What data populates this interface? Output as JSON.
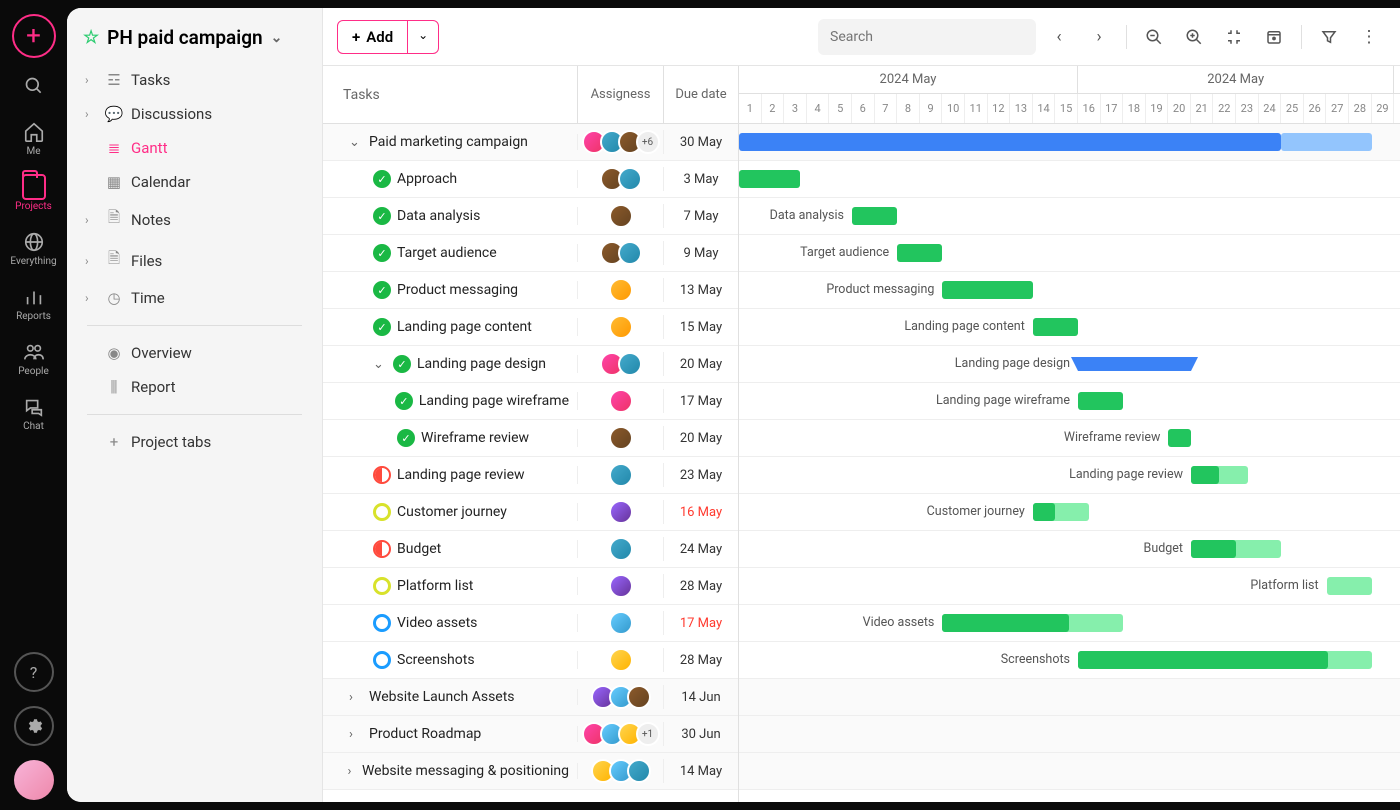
{
  "rail": {
    "items": [
      {
        "label": "Me"
      },
      {
        "label": "Projects"
      },
      {
        "label": "Everything"
      },
      {
        "label": "Reports"
      },
      {
        "label": "People"
      },
      {
        "label": "Chat"
      }
    ]
  },
  "project": {
    "title": "PH paid campaign"
  },
  "sidebar": {
    "items": [
      {
        "label": "Tasks"
      },
      {
        "label": "Discussions"
      },
      {
        "label": "Gantt"
      },
      {
        "label": "Calendar"
      },
      {
        "label": "Notes"
      },
      {
        "label": "Files"
      },
      {
        "label": "Time"
      }
    ],
    "secondary": [
      {
        "label": "Overview"
      },
      {
        "label": "Report"
      }
    ],
    "project_tabs": "Project tabs"
  },
  "toolbar": {
    "add_label": "Add",
    "search_placeholder": "Search"
  },
  "columns": {
    "tasks": "Tasks",
    "assignees": "Assigness",
    "due": "Due date"
  },
  "timeline": {
    "month_label": "2024 May",
    "days_start": 1,
    "days_end": 29,
    "split_day": 15,
    "day_width": 22.6
  },
  "tasks": [
    {
      "name": "Paid marketing campaign",
      "indent": 0,
      "chevron": "down",
      "status": null,
      "avatars": [
        "c1",
        "c2",
        "c3"
      ],
      "extra": "+6",
      "due": "30 May",
      "bar_type": "blue",
      "bar_start": 1,
      "bar_end": 25,
      "bar_ext_end": 29,
      "group": true
    },
    {
      "name": "Approach",
      "indent": 1,
      "status": "done",
      "avatars": [
        "c3",
        "c2"
      ],
      "due": "3 May",
      "bar_type": "green",
      "bar_start": 1,
      "bar_end": 3.7
    },
    {
      "name": "Data analysis",
      "indent": 1,
      "status": "done",
      "avatars": [
        "c3"
      ],
      "due": "7 May",
      "bar_type": "green",
      "bar_start": 6,
      "bar_end": 8,
      "label": "Data analysis"
    },
    {
      "name": "Target audience",
      "indent": 1,
      "status": "done",
      "avatars": [
        "c3",
        "c2"
      ],
      "due": "9 May",
      "bar_type": "green",
      "bar_start": 8,
      "bar_end": 10,
      "label": "Target audience"
    },
    {
      "name": "Product messaging",
      "indent": 1,
      "status": "done",
      "avatars": [
        "c4"
      ],
      "due": "13 May",
      "bar_type": "green",
      "bar_start": 10,
      "bar_end": 14,
      "label": "Product messaging"
    },
    {
      "name": "Landing page content",
      "indent": 1,
      "status": "done",
      "avatars": [
        "c4"
      ],
      "due": "15 May",
      "bar_type": "green",
      "bar_start": 14,
      "bar_end": 16,
      "label": "Landing page content"
    },
    {
      "name": "Landing page design",
      "indent": 1,
      "chevron": "down",
      "status": "done",
      "avatars": [
        "c1",
        "c2"
      ],
      "due": "20 May",
      "bar_type": "bracket",
      "bar_start": 16,
      "bar_end": 21,
      "label": "Landing page design"
    },
    {
      "name": "Landing page wireframe",
      "indent": 2,
      "status": "done",
      "avatars": [
        "c1"
      ],
      "due": "17 May",
      "bar_type": "green",
      "bar_start": 16,
      "bar_end": 18,
      "label": "Landing page wireframe"
    },
    {
      "name": "Wireframe review",
      "indent": 2,
      "status": "done",
      "avatars": [
        "c3"
      ],
      "due": "20 May",
      "bar_type": "green",
      "bar_start": 20,
      "bar_end": 21,
      "label": "Wireframe review"
    },
    {
      "name": "Landing page review",
      "indent": 1,
      "status": "half-red",
      "avatars": [
        "c2"
      ],
      "due": "23 May",
      "bar_type": "green-prog",
      "bar_start": 21,
      "bar_end": 23.5,
      "prog": 0.5,
      "label": "Landing page review"
    },
    {
      "name": "Customer journey",
      "indent": 1,
      "status": "ring-yellow",
      "avatars": [
        "c5"
      ],
      "due": "16 May",
      "overdue": true,
      "bar_type": "green-prog",
      "bar_start": 14,
      "bar_end": 16.5,
      "prog": 0.4,
      "label": "Customer journey"
    },
    {
      "name": "Budget",
      "indent": 1,
      "status": "half-red",
      "avatars": [
        "c2"
      ],
      "due": "24 May",
      "bar_type": "green-prog",
      "bar_start": 21,
      "bar_end": 25,
      "prog": 0.5,
      "label": "Budget"
    },
    {
      "name": "Platform list",
      "indent": 1,
      "status": "ring-yellow",
      "avatars": [
        "c5"
      ],
      "due": "28 May",
      "bar_type": "green-light",
      "bar_start": 27,
      "bar_end": 29,
      "label": "Platform list"
    },
    {
      "name": "Video assets",
      "indent": 1,
      "status": "ring-blue",
      "avatars": [
        "c6"
      ],
      "due": "17 May",
      "overdue": true,
      "bar_type": "green-prog",
      "bar_start": 10,
      "bar_end": 18,
      "prog": 0.7,
      "label": "Video assets"
    },
    {
      "name": "Screenshots",
      "indent": 1,
      "status": "ring-blue",
      "avatars": [
        "c7"
      ],
      "due": "28 May",
      "bar_type": "green-prog",
      "bar_start": 16,
      "bar_end": 29,
      "prog": 0.85,
      "label": "Screenshots"
    },
    {
      "name": "Website Launch Assets",
      "indent": 0,
      "chevron": "right",
      "avatars": [
        "c5",
        "c6",
        "c3"
      ],
      "due": "14 Jun",
      "group": true
    },
    {
      "name": "Product Roadmap",
      "indent": 0,
      "chevron": "right",
      "avatars": [
        "c1",
        "c6",
        "c7"
      ],
      "extra": "+1",
      "due": "30 Jun",
      "group": true
    },
    {
      "name": "Website messaging & positioning",
      "indent": 0,
      "chevron": "right",
      "avatars": [
        "c7",
        "c6",
        "c2"
      ],
      "due": "14 May",
      "group": true
    }
  ]
}
